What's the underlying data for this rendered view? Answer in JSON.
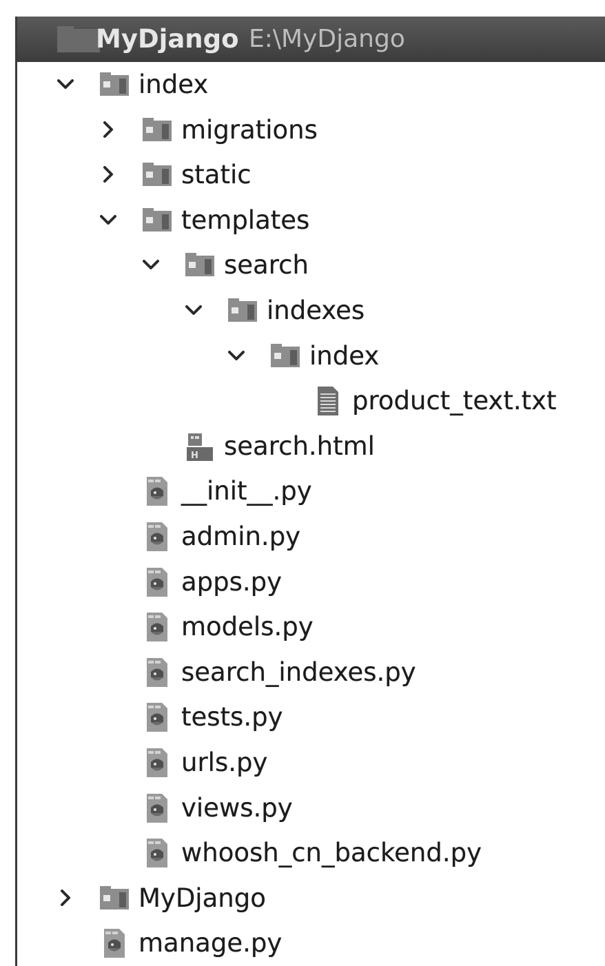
{
  "project": {
    "name": "MyDjango",
    "path": "E:\\MyDjango"
  },
  "tree": [
    {
      "label": "index",
      "type": "folder",
      "depth": 0,
      "state": "expanded",
      "name": "tree-item-index"
    },
    {
      "label": "migrations",
      "type": "folder",
      "depth": 1,
      "state": "collapsed",
      "name": "tree-item-migrations"
    },
    {
      "label": "static",
      "type": "folder",
      "depth": 1,
      "state": "collapsed",
      "name": "tree-item-static"
    },
    {
      "label": "templates",
      "type": "folder",
      "depth": 1,
      "state": "expanded",
      "name": "tree-item-templates"
    },
    {
      "label": "search",
      "type": "folder",
      "depth": 2,
      "state": "expanded",
      "name": "tree-item-search"
    },
    {
      "label": "indexes",
      "type": "folder",
      "depth": 3,
      "state": "expanded",
      "name": "tree-item-indexes"
    },
    {
      "label": "index",
      "type": "folder",
      "depth": 4,
      "state": "expanded",
      "name": "tree-item-index-sub"
    },
    {
      "label": "product_text.txt",
      "type": "txt",
      "depth": 5,
      "state": "none",
      "name": "tree-item-product-text-txt"
    },
    {
      "label": "search.html",
      "type": "html",
      "depth": 2,
      "state": "none",
      "name": "tree-item-search-html"
    },
    {
      "label": "__init__.py",
      "type": "py",
      "depth": 1,
      "state": "none",
      "name": "tree-item-init-py"
    },
    {
      "label": "admin.py",
      "type": "py",
      "depth": 1,
      "state": "none",
      "name": "tree-item-admin-py"
    },
    {
      "label": "apps.py",
      "type": "py",
      "depth": 1,
      "state": "none",
      "name": "tree-item-apps-py"
    },
    {
      "label": "models.py",
      "type": "py",
      "depth": 1,
      "state": "none",
      "name": "tree-item-models-py"
    },
    {
      "label": "search_indexes.py",
      "type": "py",
      "depth": 1,
      "state": "none",
      "name": "tree-item-search-indexes-py"
    },
    {
      "label": "tests.py",
      "type": "py",
      "depth": 1,
      "state": "none",
      "name": "tree-item-tests-py"
    },
    {
      "label": "urls.py",
      "type": "py",
      "depth": 1,
      "state": "none",
      "name": "tree-item-urls-py"
    },
    {
      "label": "views.py",
      "type": "py",
      "depth": 1,
      "state": "none",
      "name": "tree-item-views-py"
    },
    {
      "label": "whoosh_cn_backend.py",
      "type": "py",
      "depth": 1,
      "state": "none",
      "name": "tree-item-whoosh-cn-backend-py"
    },
    {
      "label": "MyDjango",
      "type": "folder",
      "depth": 0,
      "state": "collapsed",
      "name": "tree-item-mydjango"
    },
    {
      "label": "manage.py",
      "type": "py",
      "depth": 0,
      "state": "none",
      "name": "tree-item-manage-py"
    }
  ],
  "icons": {
    "folder": "folder-icon",
    "txt": "text-file-icon",
    "html": "html-file-icon",
    "py": "python-file-icon",
    "expanded": "chevron-down-icon",
    "collapsed": "chevron-right-icon"
  },
  "colors": {
    "header_bg": "#4a4a4a",
    "header_text": "#e6e6e6",
    "path_text": "#bdbdbd",
    "folder": "#8c8c8c",
    "text": "#1c1c1c"
  }
}
